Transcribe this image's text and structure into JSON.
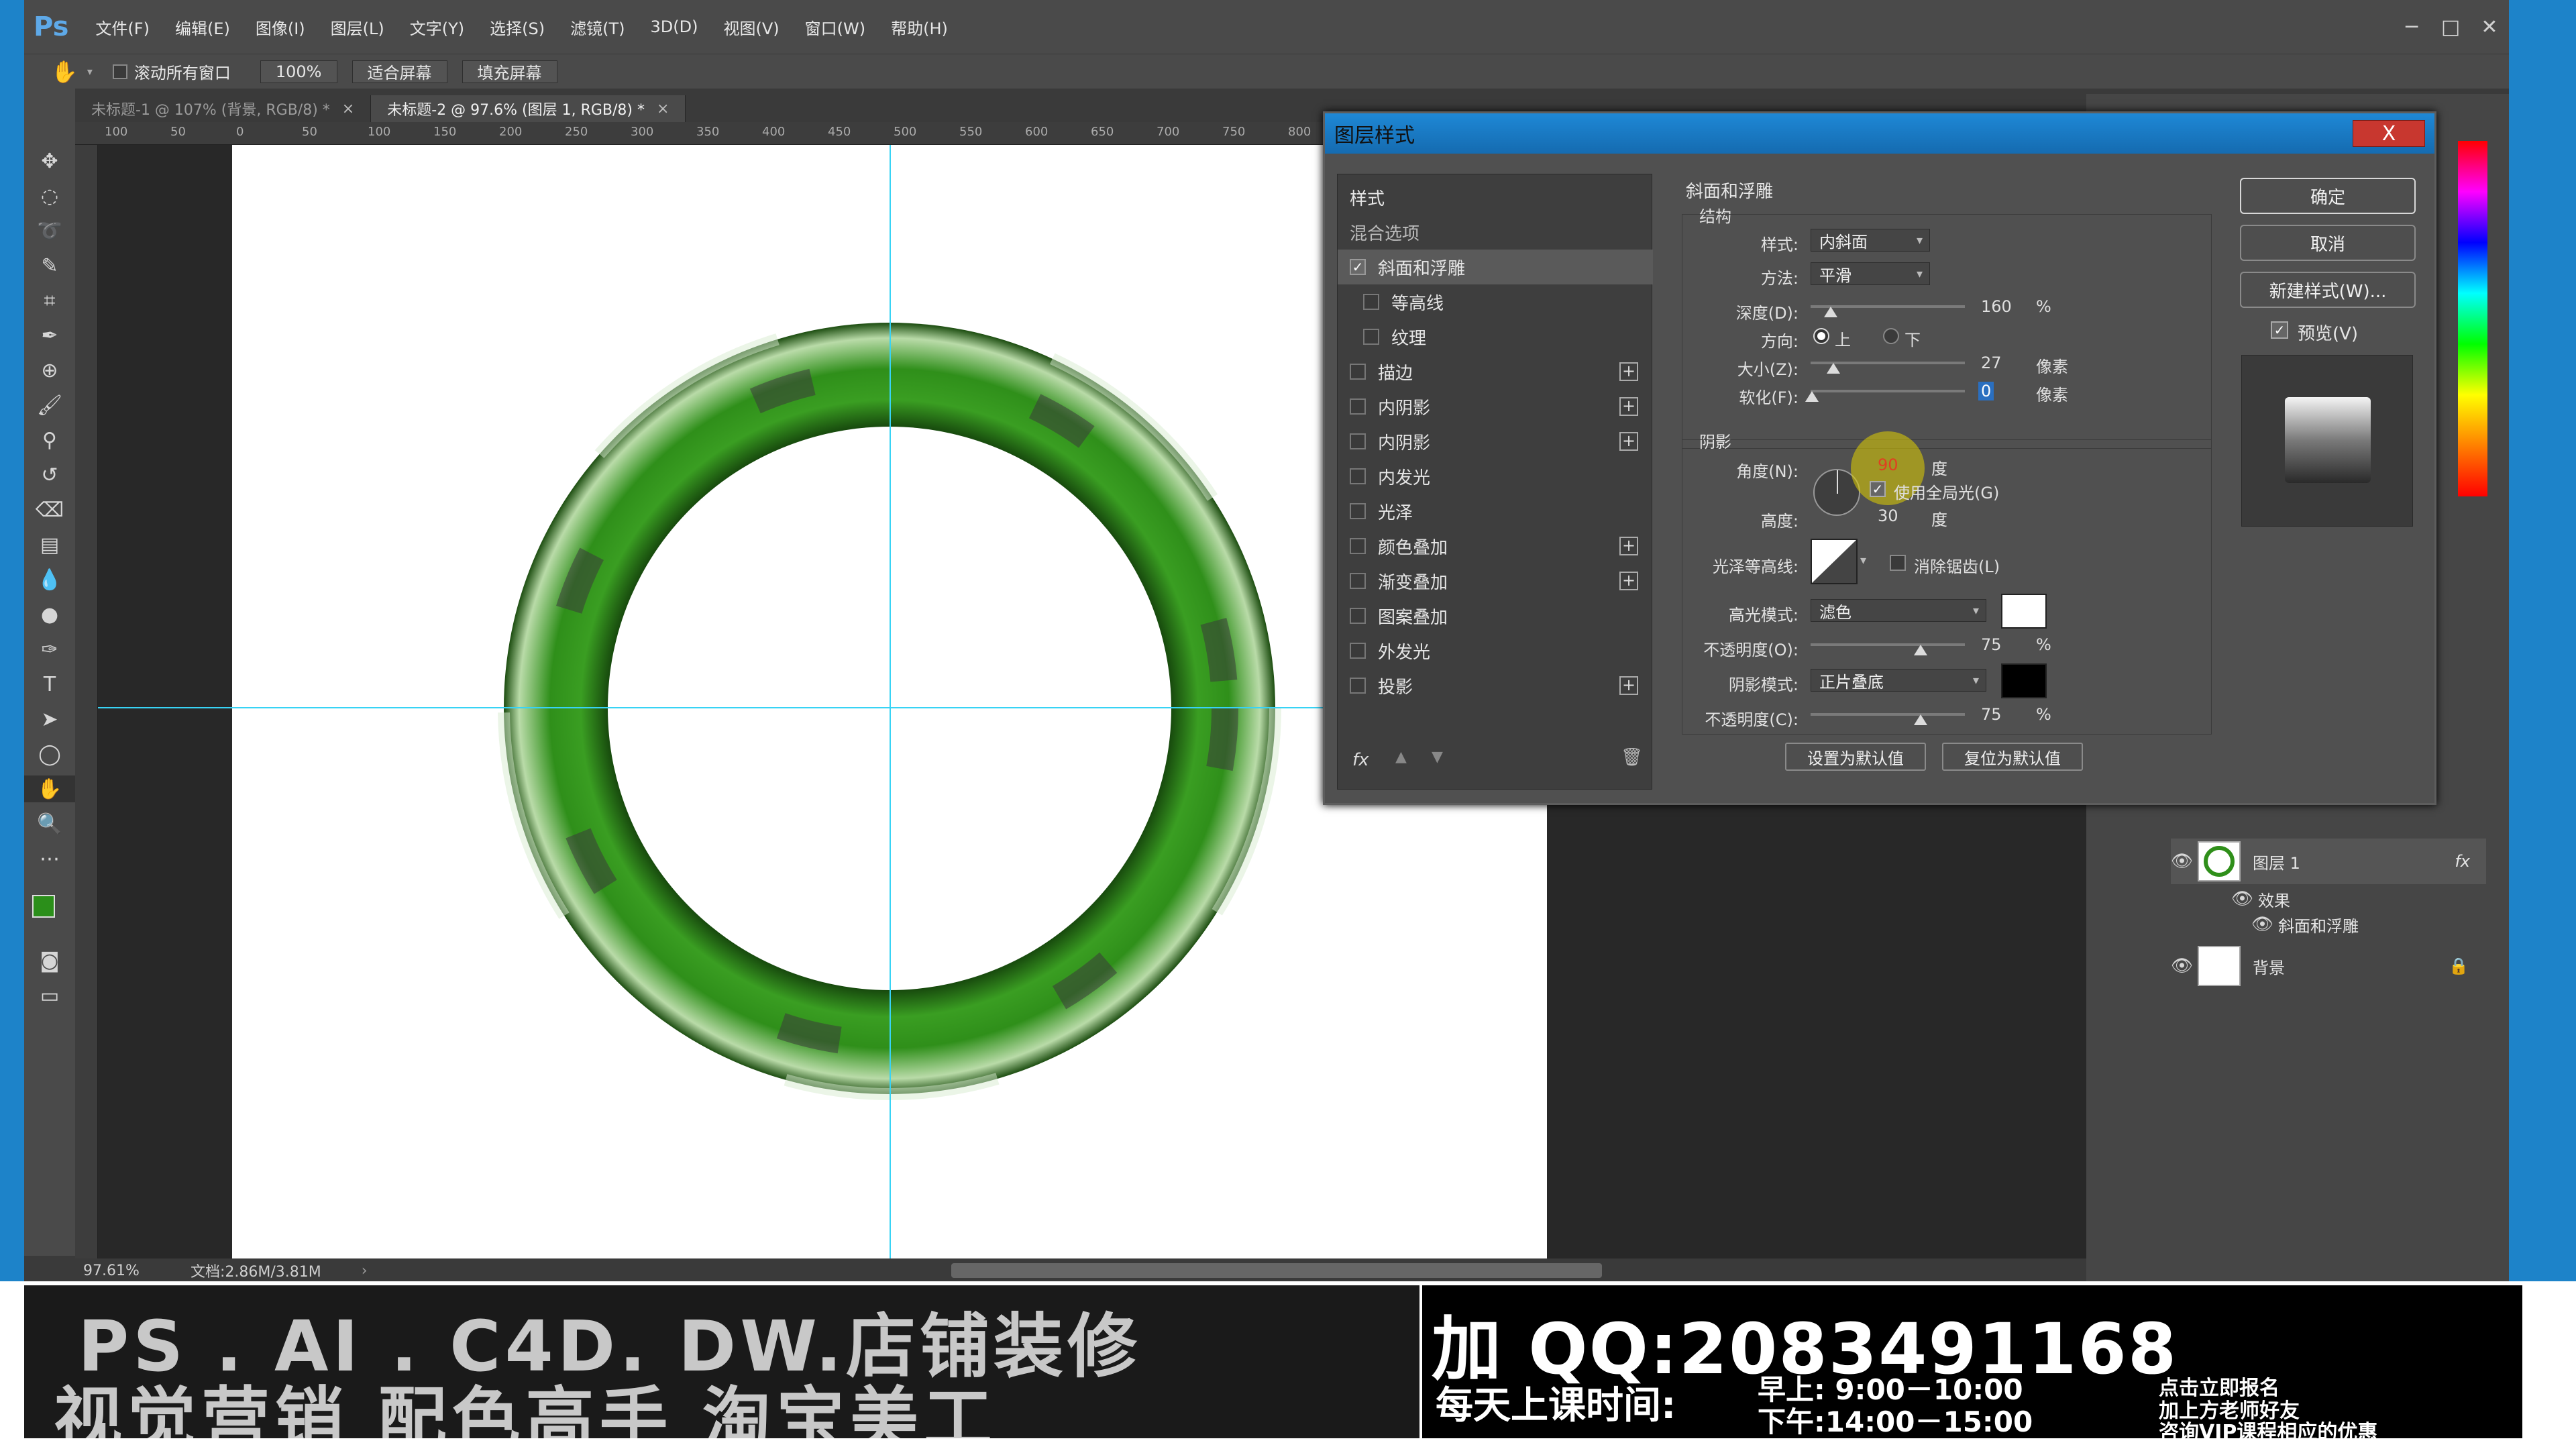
{
  "app": {
    "logo": "Ps",
    "menu": [
      "文件(F)",
      "编辑(E)",
      "图像(I)",
      "图层(L)",
      "文字(Y)",
      "选择(S)",
      "滤镜(T)",
      "3D(D)",
      "视图(V)",
      "窗口(W)",
      "帮助(H)"
    ]
  },
  "options": {
    "scroll_all_label": "滚动所有窗口",
    "zoom_btn": "100%",
    "fit_screen": "适合屏幕",
    "fill_screen": "填充屏幕"
  },
  "tabs": [
    {
      "label": "未标题-1 @ 107% (背景, RGB/8) *",
      "close": "×"
    },
    {
      "label": "未标题-2 @ 97.6% (图层 1, RGB/8) *",
      "close": "×"
    }
  ],
  "ruler": {
    "h": [
      "100",
      "50",
      "0",
      "50",
      "100",
      "150",
      "200",
      "250",
      "300",
      "350",
      "400",
      "450",
      "500",
      "550",
      "600",
      "650",
      "700",
      "750",
      "800"
    ]
  },
  "status": {
    "zoom": "97.61%",
    "doc": "文档:2.86M/3.81M"
  },
  "dialog": {
    "title": "图层样式",
    "close": "X",
    "list_header": "样式",
    "blend_options": "混合选项",
    "items": [
      {
        "label": "斜面和浮雕",
        "checked": true,
        "plus": false,
        "indent": false
      },
      {
        "label": "等高线",
        "checked": false,
        "plus": false,
        "indent": true
      },
      {
        "label": "纹理",
        "checked": false,
        "plus": false,
        "indent": true
      },
      {
        "label": "描边",
        "checked": false,
        "plus": true,
        "indent": false
      },
      {
        "label": "内阴影",
        "checked": false,
        "plus": true,
        "indent": false
      },
      {
        "label": "内阴影",
        "checked": false,
        "plus": true,
        "indent": false
      },
      {
        "label": "内发光",
        "checked": false,
        "plus": false,
        "indent": false
      },
      {
        "label": "光泽",
        "checked": false,
        "plus": false,
        "indent": false
      },
      {
        "label": "颜色叠加",
        "checked": false,
        "plus": true,
        "indent": false
      },
      {
        "label": "渐变叠加",
        "checked": false,
        "plus": true,
        "indent": false
      },
      {
        "label": "图案叠加",
        "checked": false,
        "plus": false,
        "indent": false
      },
      {
        "label": "外发光",
        "checked": false,
        "plus": false,
        "indent": false
      },
      {
        "label": "投影",
        "checked": false,
        "plus": true,
        "indent": false
      }
    ],
    "fx_label": "fx",
    "bevel": {
      "section_title": "斜面和浮雕",
      "structure_title": "结构",
      "style_label": "样式:",
      "style_value": "内斜面",
      "technique_label": "方法:",
      "technique_value": "平滑",
      "depth_label": "深度(D):",
      "depth_value": "160",
      "depth_unit": "%",
      "direction_label": "方向:",
      "dir_up": "上",
      "dir_down": "下",
      "size_label": "大小(Z):",
      "size_value": "27",
      "size_unit": "像素",
      "soften_label": "软化(F):",
      "soften_value": "0",
      "soften_unit": "像素"
    },
    "shading": {
      "title": "阴影",
      "angle_label": "角度(N):",
      "angle_value": "90",
      "angle_unit": "度",
      "global_light": "使用全局光(G)",
      "altitude_label": "高度:",
      "altitude_value": "30",
      "altitude_unit": "度",
      "gloss_label": "光泽等高线:",
      "anti_alias": "消除锯齿(L)",
      "highlight_label": "高光模式:",
      "highlight_value": "滤色",
      "hl_opacity_label": "不透明度(O):",
      "hl_opacity_value": "75",
      "hl_opacity_unit": "%",
      "shadow_label": "阴影模式:",
      "shadow_value": "正片叠底",
      "sh_opacity_label": "不透明度(C):",
      "sh_opacity_value": "75",
      "sh_opacity_unit": "%",
      "make_default": "设置为默认值",
      "reset_default": "复位为默认值"
    },
    "buttons": {
      "ok": "确定",
      "cancel": "取消",
      "new_style": "新建样式(W)...",
      "preview": "预览(V)"
    },
    "colors": {
      "highlight": "#ffffff",
      "shadow": "#000000"
    }
  },
  "layers": {
    "layer1": "图层 1",
    "effects": "效果",
    "bevel": "斜面和浮雕",
    "background": "背景",
    "fx": "fx"
  },
  "banner": {
    "left_line1": "PS . AI . C4D. DW.店铺装修",
    "left_line2": "视觉营销  配色高手  淘宝美工",
    "qq": "加 QQ:2083491168",
    "schedule_label": "每天上课时间:",
    "morning": "早上: 9:00－10:00",
    "afternoon": "下午:14:00－15:00",
    "promo1": "点击立即报名",
    "promo2": "加上方老师好友",
    "promo3": "咨询VIP课程相应的优惠"
  },
  "colors": {
    "ring_green": "#2f8f1a",
    "accent_blue": "#1e88d6",
    "guide": "#38d3f5"
  }
}
